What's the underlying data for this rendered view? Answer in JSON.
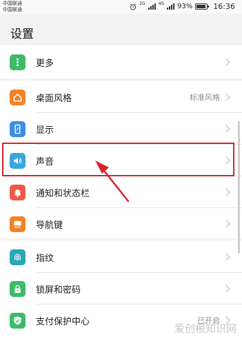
{
  "status_bar": {
    "carrier1": "中国联通",
    "carrier2": "中国联通",
    "net1": "2G",
    "net2": "4G",
    "battery": "93%",
    "time": "16:36"
  },
  "page": {
    "title": "设置"
  },
  "items": [
    {
      "label": "更多",
      "icon": "more-dots-icon",
      "color": "#3dbb6b"
    },
    {
      "label": "桌面风格",
      "value": "标准风格",
      "icon": "home-icon",
      "color": "#f0832a"
    },
    {
      "label": "显示",
      "icon": "phone-display-icon",
      "color": "#3d8ee6"
    },
    {
      "label": "声音",
      "icon": "speaker-icon",
      "color": "#3aa6df"
    },
    {
      "label": "通知和状态栏",
      "icon": "bell-icon",
      "color": "#ef5a49"
    },
    {
      "label": "导航键",
      "icon": "navigation-key-icon",
      "color": "#f0832a"
    },
    {
      "label": "指纹",
      "icon": "fingerprint-icon",
      "color": "#2aa7b8"
    },
    {
      "label": "锁屏和密码",
      "icon": "lock-icon",
      "color": "#3dbb6b"
    },
    {
      "label": "支付保护中心",
      "value": "已开启",
      "icon": "shield-check-icon",
      "color": "#3dbb6b"
    }
  ],
  "highlight_color": "#d5222d",
  "watermark": "爱创根知识网"
}
